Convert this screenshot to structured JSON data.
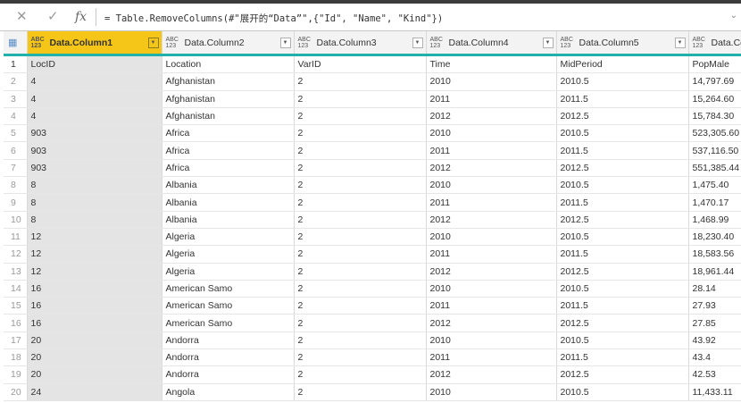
{
  "formula_bar": {
    "cancel_glyph": "✕",
    "commit_glyph": "✓",
    "fx_label": "fx",
    "formula": "= Table.RemoveColumns(#\"展开的“Data”\",{\"Id\", \"Name\", \"Kind\"})",
    "expand_glyph": "⌄"
  },
  "colors": {
    "accent": "#20b2aa",
    "active_header": "#f5c518",
    "selected_column": "#e4e4e4"
  },
  "columns": [
    {
      "type_top": "ABC",
      "type_bottom": "123",
      "name": "Data.Column1"
    },
    {
      "type_top": "ABC",
      "type_bottom": "123",
      "name": "Data.Column2"
    },
    {
      "type_top": "ABC",
      "type_bottom": "123",
      "name": "Data.Column3"
    },
    {
      "type_top": "ABC",
      "type_bottom": "123",
      "name": "Data.Column4"
    },
    {
      "type_top": "ABC",
      "type_bottom": "123",
      "name": "Data.Column5"
    },
    {
      "type_top": "ABC",
      "type_bottom": "123",
      "name": "Data.Col"
    }
  ],
  "rows": [
    {
      "n": "1",
      "cells": [
        "LocID",
        "Location",
        "VarID",
        "Time",
        "MidPeriod",
        "PopMale"
      ]
    },
    {
      "n": "2",
      "cells": [
        "4",
        "Afghanistan",
        "2",
        "2010",
        "2010.5",
        "14,797.69"
      ]
    },
    {
      "n": "3",
      "cells": [
        "4",
        "Afghanistan",
        "2",
        "2011",
        "2011.5",
        "15,264.60"
      ]
    },
    {
      "n": "4",
      "cells": [
        "4",
        "Afghanistan",
        "2",
        "2012",
        "2012.5",
        "15,784.30"
      ]
    },
    {
      "n": "5",
      "cells": [
        "903",
        "Africa",
        "2",
        "2010",
        "2010.5",
        "523,305.60"
      ]
    },
    {
      "n": "6",
      "cells": [
        "903",
        "Africa",
        "2",
        "2011",
        "2011.5",
        "537,116.50"
      ]
    },
    {
      "n": "7",
      "cells": [
        "903",
        "Africa",
        "2",
        "2012",
        "2012.5",
        "551,385.44"
      ]
    },
    {
      "n": "8",
      "cells": [
        "8",
        "Albania",
        "2",
        "2010",
        "2010.5",
        "1,475.40"
      ]
    },
    {
      "n": "9",
      "cells": [
        "8",
        "Albania",
        "2",
        "2011",
        "2011.5",
        "1,470.17"
      ]
    },
    {
      "n": "10",
      "cells": [
        "8",
        "Albania",
        "2",
        "2012",
        "2012.5",
        "1,468.99"
      ]
    },
    {
      "n": "11",
      "cells": [
        "12",
        "Algeria",
        "2",
        "2010",
        "2010.5",
        "18,230.40"
      ]
    },
    {
      "n": "12",
      "cells": [
        "12",
        "Algeria",
        "2",
        "2011",
        "2011.5",
        "18,583.56"
      ]
    },
    {
      "n": "13",
      "cells": [
        "12",
        "Algeria",
        "2",
        "2012",
        "2012.5",
        "18,961.44"
      ]
    },
    {
      "n": "14",
      "cells": [
        "16",
        "American Samo",
        "2",
        "2010",
        "2010.5",
        "28.14"
      ]
    },
    {
      "n": "15",
      "cells": [
        "16",
        "American Samo",
        "2",
        "2011",
        "2011.5",
        "27.93"
      ]
    },
    {
      "n": "16",
      "cells": [
        "16",
        "American Samo",
        "2",
        "2012",
        "2012.5",
        "27.85"
      ]
    },
    {
      "n": "17",
      "cells": [
        "20",
        "Andorra",
        "2",
        "2010",
        "2010.5",
        "43.92"
      ]
    },
    {
      "n": "18",
      "cells": [
        "20",
        "Andorra",
        "2",
        "2011",
        "2011.5",
        "43.4"
      ]
    },
    {
      "n": "19",
      "cells": [
        "20",
        "Andorra",
        "2",
        "2012",
        "2012.5",
        "42.53"
      ]
    },
    {
      "n": "20",
      "cells": [
        "24",
        "Angola",
        "2",
        "2010",
        "2010.5",
        "11,433.11"
      ]
    }
  ]
}
